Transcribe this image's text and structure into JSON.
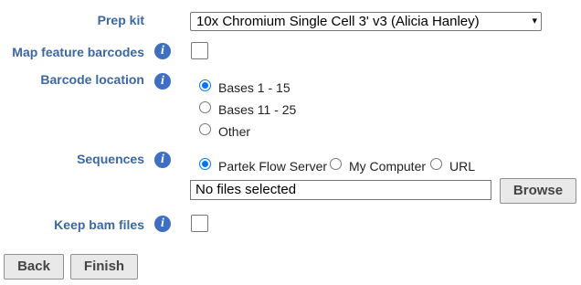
{
  "prep_kit": {
    "label": "Prep kit",
    "selected": "10x Chromium Single Cell 3' v3 (Alicia Hanley)"
  },
  "map_feature_barcodes": {
    "label": "Map feature barcodes",
    "checked": false
  },
  "barcode_location": {
    "label": "Barcode location",
    "options": [
      "Bases 1 - 15",
      "Bases 11 - 25",
      "Other"
    ],
    "selected": "Bases 1 - 15"
  },
  "sequences": {
    "label": "Sequences",
    "sources": [
      "Partek Flow Server",
      "My Computer",
      "URL"
    ],
    "selected_source": "Partek Flow Server",
    "file_value": "No files selected",
    "browse_label": "Browse"
  },
  "keep_bam_files": {
    "label": "Keep bam files",
    "checked": false
  },
  "info_glyph": "i",
  "chevron_glyph": "▾",
  "footer": {
    "back_label": "Back",
    "finish_label": "Finish"
  },
  "colors": {
    "label": "#3a67a8",
    "info_icon": "#3f6fc3",
    "radio_selected": "#0075ff"
  }
}
